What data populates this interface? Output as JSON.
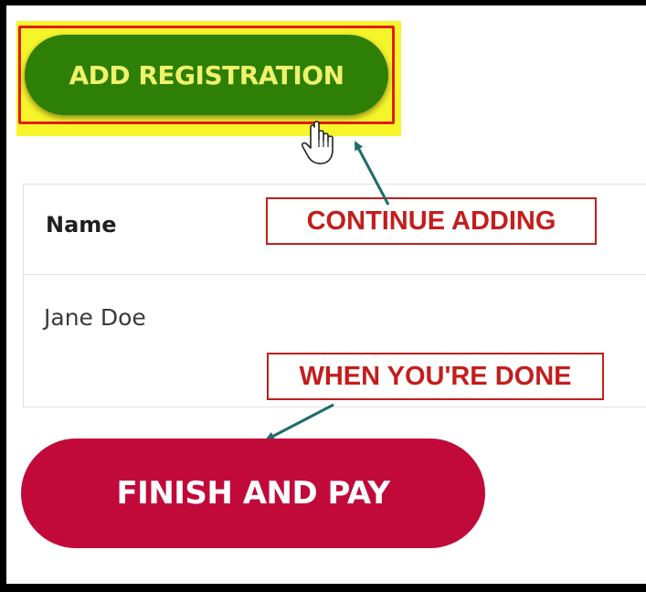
{
  "actions": {
    "add_registration_label": "ADD REGISTRATION",
    "finish_and_pay_label": "FINISH AND PAY"
  },
  "table": {
    "header_name": "Name",
    "rows": [
      {
        "name": "Jane Doe"
      }
    ]
  },
  "annotations": {
    "continue_adding": "CONTINUE ADDING",
    "when_done": "WHEN YOU'RE DONE"
  },
  "colors": {
    "add_button": "#2d7f06",
    "add_button_text": "#eef26b",
    "highlight": "#f5f52a",
    "callout_red": "#c41d1d",
    "finish_button": "#c10a3a",
    "arrow": "#1f6b6b"
  },
  "icons": {
    "cursor": "hand-pointer-icon"
  }
}
